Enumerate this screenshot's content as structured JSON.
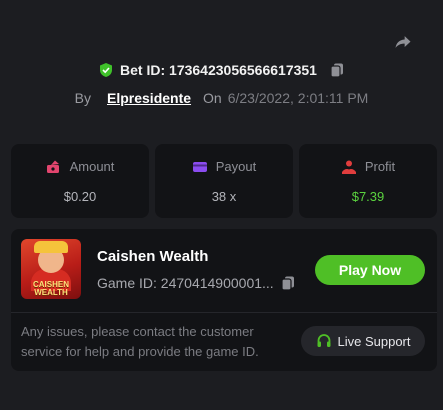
{
  "header": {
    "share_icon": "share-icon",
    "bet_id_label": "Bet ID: 1736423056566617351",
    "by_label": "By",
    "username": "Elpresidente",
    "on_label": "On",
    "date": "6/23/2022, 2:01:11 PM"
  },
  "stats": {
    "amount": {
      "label": "Amount",
      "value": "$0.20",
      "icon": "amount-icon"
    },
    "payout": {
      "label": "Payout",
      "value": "38 x",
      "icon": "card-icon"
    },
    "profit": {
      "label": "Profit",
      "value": "$7.39",
      "icon": "profit-icon"
    }
  },
  "game": {
    "name": "Caishen Wealth",
    "thumbnail_text": "CAISHEN WEALTH",
    "game_id": "Game ID: 2470414900001...",
    "play_label": "Play Now"
  },
  "support": {
    "message": "Any issues, please contact the customer service for help and provide the game ID.",
    "button_label": "Live Support"
  },
  "colors": {
    "background": "#1c1d21",
    "card": "#121316",
    "accent_green": "#4fbf26",
    "profit_green": "#5bd33f",
    "amount_pink": "#e2456e",
    "payout_purple": "#8b4cf0",
    "profit_red": "#e03d3d"
  }
}
